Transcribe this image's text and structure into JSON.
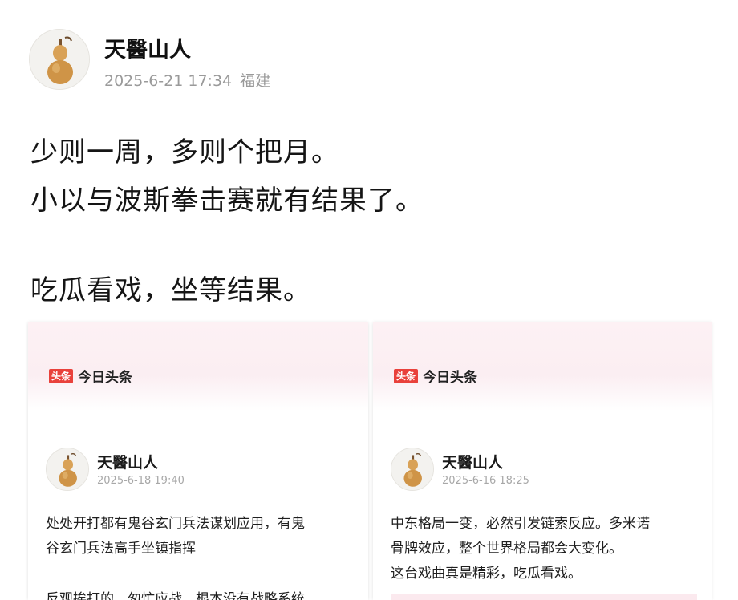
{
  "post": {
    "author": "天醫山人",
    "date": "2025-6-21 17:34",
    "location": "福建",
    "lines": [
      "少则一周，多则个把月。",
      "小以与波斯拳击赛就有结果了。",
      "吃瓜看戏，坐等结果。"
    ],
    "avatar_icon": "gourd-icon"
  },
  "cards": [
    {
      "brand_logo": "头条",
      "brand_name": "今日头条",
      "author": "天醫山人",
      "time": "2025-6-18 19:40",
      "lines": [
        "处处开打都有鬼谷玄门兵法谋划应用，有鬼",
        "谷玄门兵法高手坐镇指挥",
        "反观挨打的，匆忙应战，根本没有战略系统"
      ]
    },
    {
      "brand_logo": "头条",
      "brand_name": "今日头条",
      "author": "天醫山人",
      "time": "2025-6-16 18:25",
      "lines": [
        "中东格局一变，必然引发链索反应。多米诺",
        "骨牌效应，整个世界格局都会大变化。",
        "这台戏曲真是精彩，吃瓜看戏。"
      ]
    }
  ],
  "colors": {
    "brand_red": "#e9413b",
    "meta_gray": "#9a9a9a",
    "card_header_pink": "#fdf1f4"
  }
}
